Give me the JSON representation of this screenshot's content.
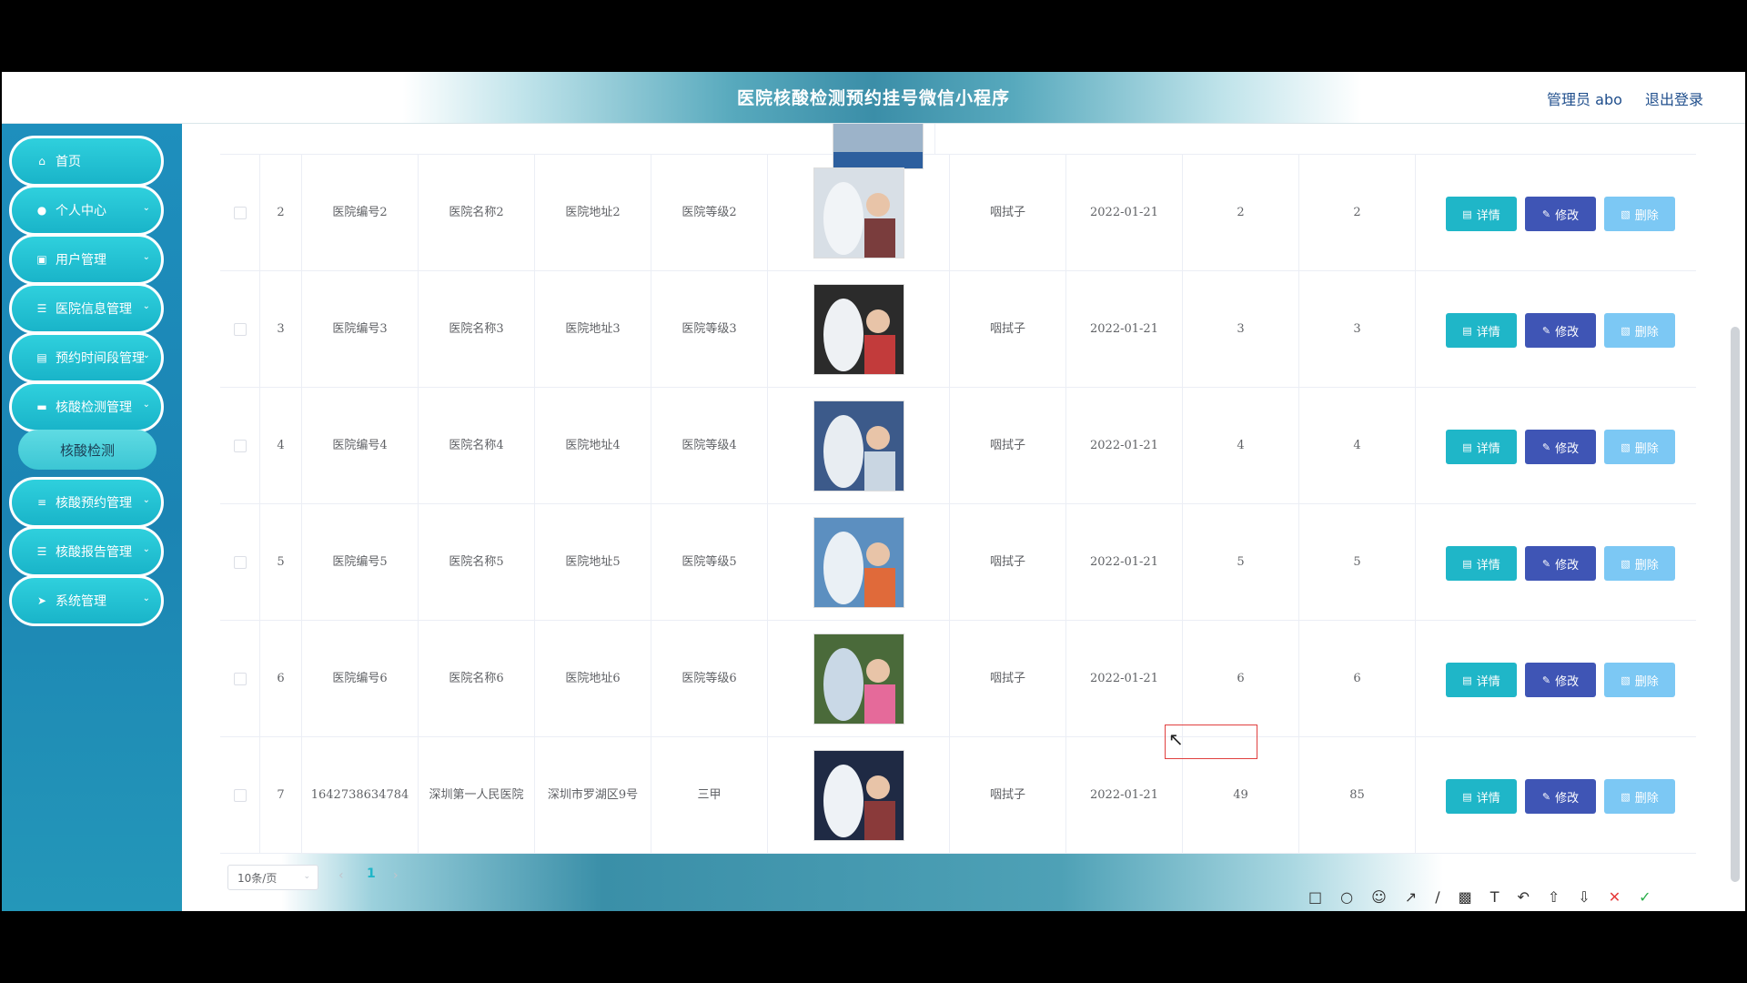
{
  "header": {
    "title": "医院核酸检测预约挂号微信小程序",
    "user_label": "管理员 abo",
    "logout_label": "退出登录"
  },
  "sidebar": {
    "items": [
      {
        "label": "首页",
        "icon": "home-icon"
      },
      {
        "label": "个人中心",
        "icon": "user-icon"
      },
      {
        "label": "用户管理",
        "icon": "briefcase-icon"
      },
      {
        "label": "医院信息管理",
        "icon": "list-icon"
      },
      {
        "label": "预约时间段管理",
        "icon": "clipboard-icon"
      },
      {
        "label": "核酸检测管理",
        "icon": "monitor-icon"
      },
      {
        "label": "核酸预约管理",
        "icon": "sliders-icon"
      },
      {
        "label": "核酸报告管理",
        "icon": "list-icon"
      },
      {
        "label": "系统管理",
        "icon": "send-icon"
      }
    ],
    "sub_item": "核酸检测"
  },
  "table": {
    "rows": [
      {
        "index": "2",
        "code": "医院编号2",
        "name": "医院名称2",
        "address": "医院地址2",
        "level": "医院等级2",
        "method": "咽拭子",
        "date": "2022-01-21",
        "v1": "2",
        "v2": "2"
      },
      {
        "index": "3",
        "code": "医院编号3",
        "name": "医院名称3",
        "address": "医院地址3",
        "level": "医院等级3",
        "method": "咽拭子",
        "date": "2022-01-21",
        "v1": "3",
        "v2": "3"
      },
      {
        "index": "4",
        "code": "医院编号4",
        "name": "医院名称4",
        "address": "医院地址4",
        "level": "医院等级4",
        "method": "咽拭子",
        "date": "2022-01-21",
        "v1": "4",
        "v2": "4"
      },
      {
        "index": "5",
        "code": "医院编号5",
        "name": "医院名称5",
        "address": "医院地址5",
        "level": "医院等级5",
        "method": "咽拭子",
        "date": "2022-01-21",
        "v1": "5",
        "v2": "5"
      },
      {
        "index": "6",
        "code": "医院编号6",
        "name": "医院名称6",
        "address": "医院地址6",
        "level": "医院等级6",
        "method": "咽拭子",
        "date": "2022-01-21",
        "v1": "6",
        "v2": "6"
      },
      {
        "index": "7",
        "code": "1642738634784",
        "name": "深圳第一人民医院",
        "address": "深圳市罗湖区9号",
        "level": "三甲",
        "method": "咽拭子",
        "date": "2022-01-21",
        "v1": "49",
        "v2": "85"
      }
    ],
    "actions": {
      "detail": "详情",
      "edit": "修改",
      "delete": "删除"
    }
  },
  "pagination": {
    "page_size": "10条/页",
    "current": "1"
  },
  "colors": {
    "accent": "#1fb6c8",
    "edit": "#3f55b5",
    "delete": "#7cc8f4",
    "sidebar": "#1e8fbd"
  }
}
